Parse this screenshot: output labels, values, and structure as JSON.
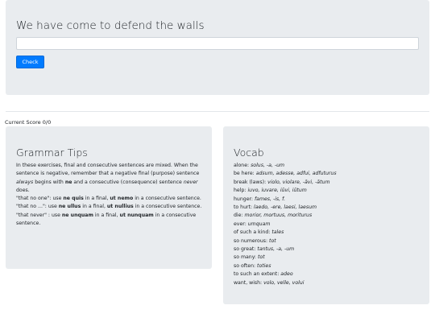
{
  "exercise": {
    "prompt": "We have come to defend the walls",
    "input_value": "",
    "input_placeholder": "",
    "check_label": "Check"
  },
  "score": {
    "label": "Current Score",
    "value": "0/0"
  },
  "grammar": {
    "title": "Grammar Tips",
    "p1_a": "In these exercises, final and consecutive sentences are mixed. When the sentence is negative, remember that a negative final (purpose) sentence ",
    "p1_always": "always",
    "p1_b": " begins with ",
    "p1_ne": "ne",
    "p1_c": " and a consecutive (consequence) sentence ",
    "p1_never": "never",
    "p1_d": " does.",
    "p2_a": "\"that no one\": use ",
    "p2_b1": "ne quis",
    "p2_c": " in a final, ",
    "p2_b2": "ut nemo",
    "p2_d": " in a consecutive sentence.",
    "p3_a": "\"that no ...\": use ",
    "p3_b1": "ne ullus",
    "p3_c": " in a final, ",
    "p3_b2": "ut nullius",
    "p3_d": " in a consecutive sentence.",
    "p4_a": "\"that never\" : use ",
    "p4_b1": "ne unquam",
    "p4_c": " in a final, ",
    "p4_b2": "ut nunquam",
    "p4_d": " in a consecutive sentence."
  },
  "vocab": {
    "title": "Vocab",
    "items": [
      {
        "term": "alone: ",
        "forms": "solus, -a, -um"
      },
      {
        "term": "be here: ",
        "forms": "adsum, adesse, adfui, adfuturus"
      },
      {
        "term": "break (laws): ",
        "forms": "violo, violare, -āvi, -ātum"
      },
      {
        "term": "help: ",
        "forms": "iuvo, iuvare, iūvi, iūtum"
      },
      {
        "term": "hunger: ",
        "forms": "fames, -is, f."
      },
      {
        "term": "to hurt: ",
        "forms": "laedo, -ere, laesi, laesum"
      },
      {
        "term": "die: ",
        "forms": "morior, mortuus, moriturus"
      },
      {
        "term": "ever: ",
        "forms": "umquam"
      },
      {
        "term": "of such a kind: ",
        "forms": "tales"
      },
      {
        "term": "so numerous: ",
        "forms": "tot"
      },
      {
        "term": "so great: ",
        "forms": "tantus, -a, -um"
      },
      {
        "term": "so many: ",
        "forms": "tot"
      },
      {
        "term": "so often: ",
        "forms": "toties"
      },
      {
        "term": "to such an extent: ",
        "forms": "adeo"
      },
      {
        "term": "want, wish: ",
        "forms": "volo, velle, volui"
      }
    ]
  },
  "colors": {
    "panel_bg": "#e9ecef",
    "button_bg": "#007bff",
    "text": "#212529"
  }
}
